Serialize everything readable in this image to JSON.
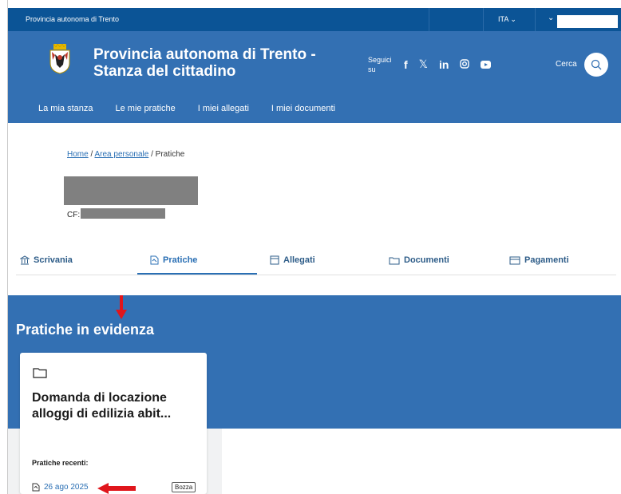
{
  "topbar": {
    "org": "Provincia autonoma di Trento",
    "lang": "ITA"
  },
  "header": {
    "title_line1": "Provincia autonoma di Trento -",
    "title_line2": "Stanza del cittadino",
    "follow_line1": "Seguici",
    "follow_line2": "su",
    "search_label": "Cerca"
  },
  "nav": [
    "La mia stanza",
    "Le mie pratiche",
    "I miei allegati",
    "I miei documenti"
  ],
  "breadcrumb": {
    "home": "Home",
    "sep": "/",
    "area": "Area personale",
    "current": "Pratiche"
  },
  "profile": {
    "cf_label": "CF:"
  },
  "tabs": [
    "Scrivania",
    "Pratiche",
    "Allegati",
    "Documenti",
    "Pagamenti"
  ],
  "section": {
    "title": "Pratiche in evidenza"
  },
  "card": {
    "title": "Domanda di locazione alloggi di edilizia abit...",
    "recent_label": "Pratiche recenti:",
    "recent_date": "26 ago 2025",
    "recent_badge": "Bozza"
  },
  "colors": {
    "topbar": "#0b5496",
    "header": "#3370b3",
    "accent": "#2a6fb4",
    "annotation": "#e0161c"
  }
}
